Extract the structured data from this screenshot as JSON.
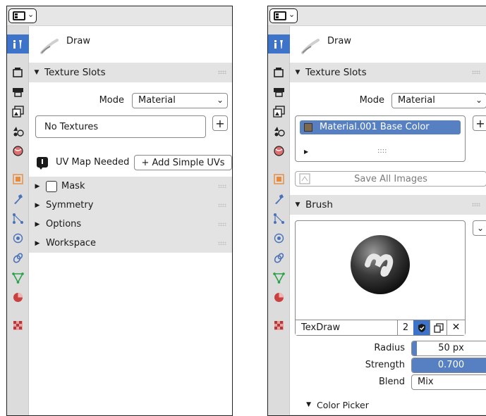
{
  "colors": {
    "accent": "#3d73c9",
    "header_bg": "#e3e3e3",
    "tab_bar": "#dcdcdc"
  },
  "left": {
    "tool": {
      "name": "Draw",
      "icon": "brush-icon"
    },
    "texture_slots": {
      "title": "Texture Slots"
    },
    "mode": {
      "label": "Mode",
      "value": "Material"
    },
    "textures_box": {
      "text": "No Textures",
      "add_button": "+"
    },
    "uv_warning": {
      "text": "UV Map Needed",
      "button": "+ Add Simple UVs"
    },
    "subpanels": [
      {
        "label": "Mask"
      },
      {
        "label": "Symmetry"
      },
      {
        "label": "Options"
      },
      {
        "label": "Workspace"
      }
    ]
  },
  "right": {
    "tool": {
      "name": "Draw",
      "icon": "brush-icon"
    },
    "texture_slots": {
      "title": "Texture Slots"
    },
    "mode": {
      "label": "Mode",
      "value": "Material"
    },
    "slot_list": {
      "selected_item": "Material.001 Base Color",
      "grip": "::::",
      "add_button": "+"
    },
    "save_all": "Save All Images",
    "brush": {
      "title": "Brush",
      "name": "TexDraw",
      "users": "2",
      "radius": {
        "label": "Radius",
        "value": "50 px",
        "fill": 0.06
      },
      "strength": {
        "label": "Strength",
        "value": "0.700",
        "fill": 1.0
      },
      "blend": {
        "label": "Blend",
        "value": "Mix"
      },
      "color_picker": "Color Picker"
    }
  },
  "tab_icons": [
    "tool-icon",
    "render-icon",
    "output-icon",
    "view-layer-icon",
    "scene-icon",
    "world-icon",
    "object-icon",
    "modifier-icon",
    "particles-icon",
    "physics-icon",
    "constraints-icon",
    "data-icon",
    "material-icon",
    "texture-icon"
  ]
}
